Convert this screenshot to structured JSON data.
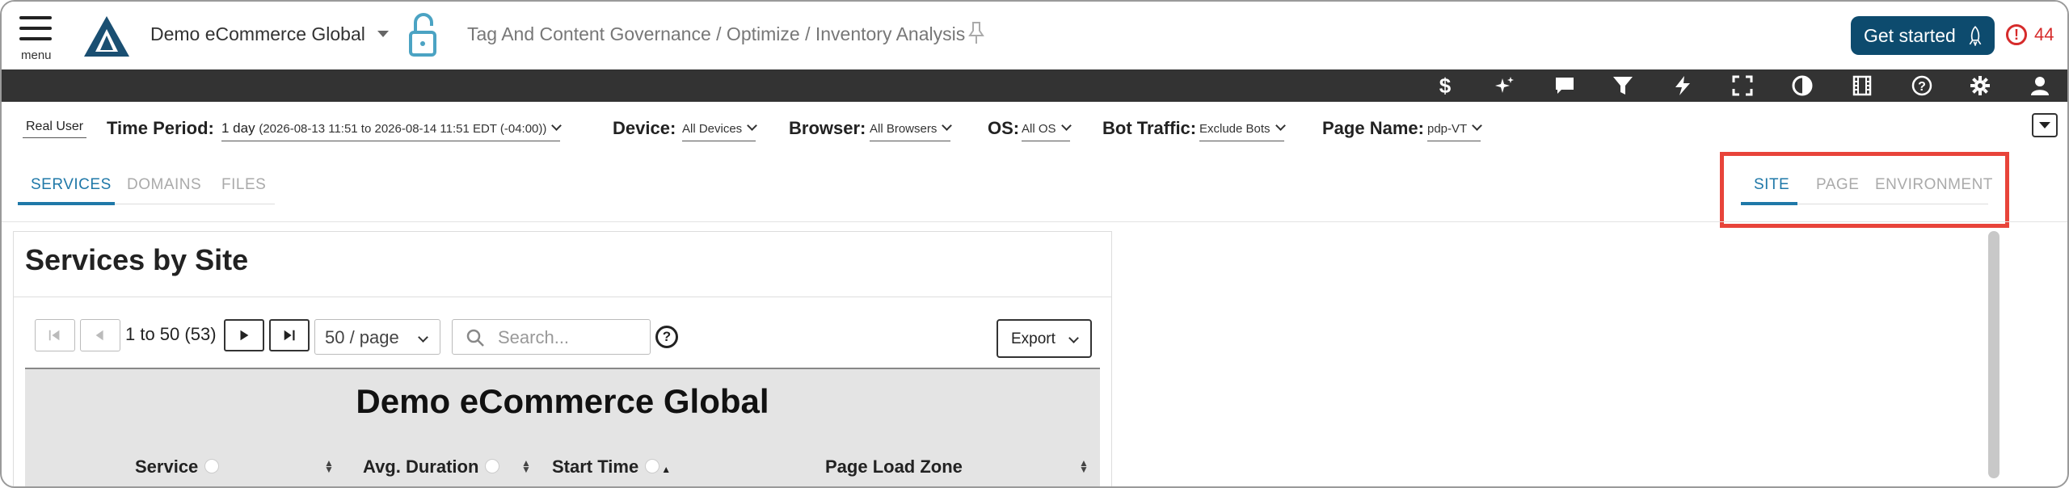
{
  "header": {
    "menu_label": "menu",
    "app_title": "Demo eCommerce Global",
    "breadcrumb": "Tag And Content Governance / Optimize / Inventory Analysis",
    "get_started_label": "Get started",
    "alert_count": "44",
    "colors": {
      "brand": "#0d4b6e",
      "alert": "#d62b2b",
      "lock": "#4ba3c3"
    }
  },
  "toolbar": {
    "icons": [
      "dollar-icon",
      "sparkle-icon",
      "chat-icon",
      "filter-icon",
      "lightning-icon",
      "fullscreen-icon",
      "contrast-icon",
      "film-icon",
      "help-icon",
      "gear-icon",
      "user-icon"
    ]
  },
  "filters": {
    "real_user": "Real User",
    "time_period": {
      "label": "Time Period:",
      "value": "1 day",
      "detail": "(2026-08-13 11:51 to 2026-08-14 11:51 EDT (-04:00))"
    },
    "device": {
      "label": "Device:",
      "value": "All Devices"
    },
    "browser": {
      "label": "Browser:",
      "value": "All Browsers"
    },
    "os": {
      "label": "OS:",
      "value": "All OS"
    },
    "bot_traffic": {
      "label": "Bot Traffic:",
      "value": "Exclude Bots"
    },
    "page_name": {
      "label": "Page Name:",
      "value": "pdp-VT"
    }
  },
  "tabs_left": [
    {
      "label": "SERVICES",
      "active": true
    },
    {
      "label": "DOMAINS",
      "active": false
    },
    {
      "label": "FILES",
      "active": false
    }
  ],
  "tabs_right": [
    {
      "label": "SITE",
      "active": true
    },
    {
      "label": "PAGE",
      "active": false
    },
    {
      "label": "ENVIRONMENT",
      "active": false
    }
  ],
  "panel": {
    "title": "Services by Site",
    "pagination": {
      "range": "1 to 50 (53)",
      "per_page": "50 / page",
      "search_placeholder": "Search...",
      "export_label": "Export"
    },
    "table": {
      "caption": "Demo eCommerce Global",
      "columns": [
        "Service",
        "Avg. Duration",
        "Start Time",
        "Page Load Zone"
      ]
    }
  },
  "accent_color": "#1f78a8",
  "highlight_color": "#e8443a"
}
